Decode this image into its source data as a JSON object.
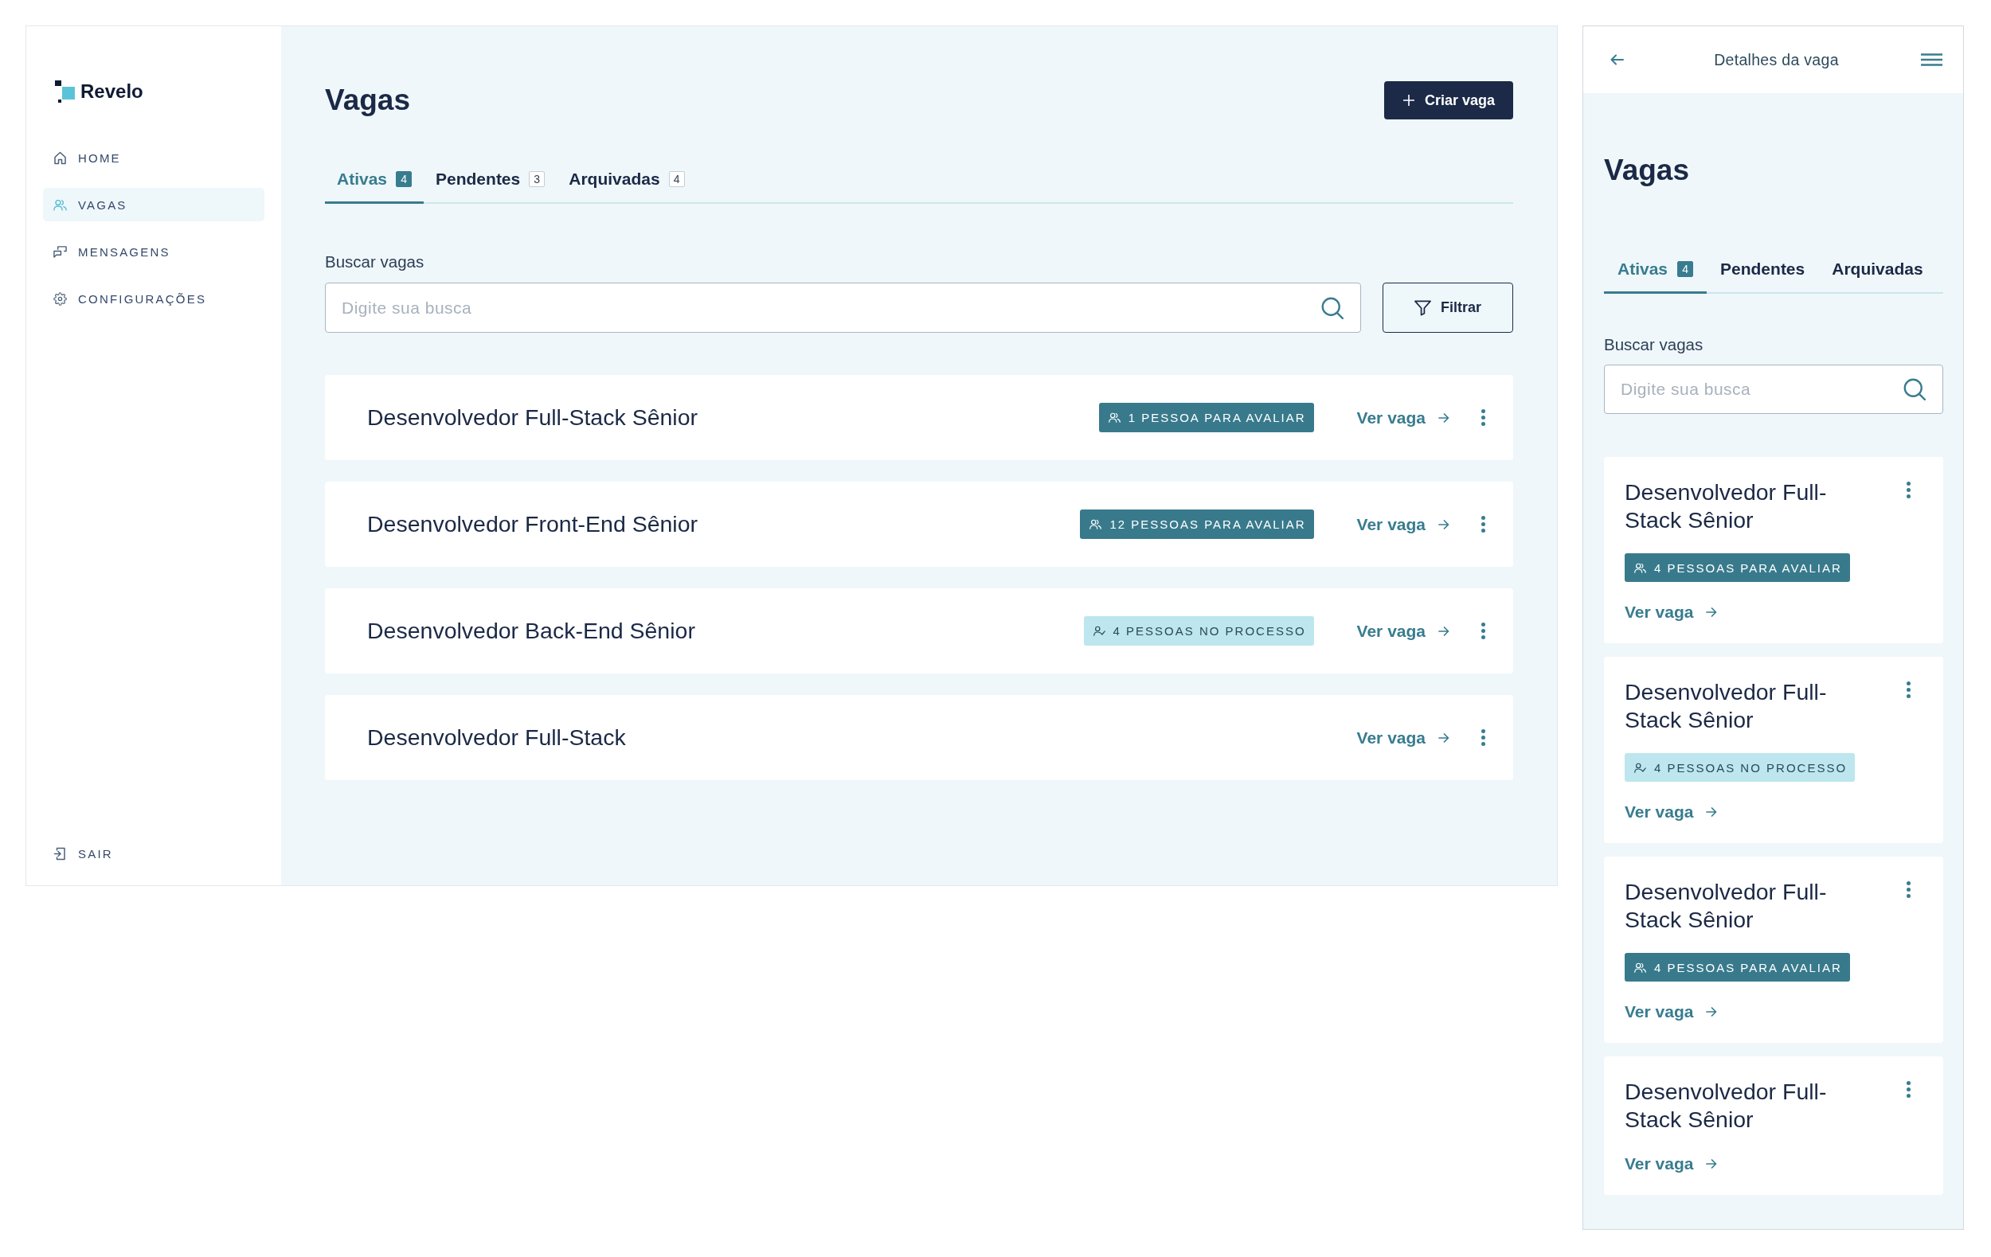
{
  "sidebar": {
    "logo": "Revelo",
    "items": [
      {
        "label": "HOME",
        "selected": false
      },
      {
        "label": "VAGAS",
        "selected": true
      },
      {
        "label": "MENSAGENS",
        "selected": false
      },
      {
        "label": "CONFIGURAÇÕES",
        "selected": false
      }
    ],
    "logout": "SAIR"
  },
  "main": {
    "title": "Vagas",
    "create_button": "Criar vaga",
    "tabs": [
      {
        "label": "Ativas",
        "count": "4",
        "selected": true
      },
      {
        "label": "Pendentes",
        "count": "3",
        "selected": false
      },
      {
        "label": "Arquivadas",
        "count": "4",
        "selected": false
      }
    ],
    "search": {
      "label": "Buscar vagas",
      "placeholder": "Digite sua busca"
    },
    "filter_button": "Filtrar",
    "jobs": [
      {
        "title": "Desenvolvedor Full-Stack Sênior",
        "badge": {
          "kind": "review",
          "text": "1 PESSOA PARA AVALIAR"
        },
        "link": "Ver vaga"
      },
      {
        "title": "Desenvolvedor Front-End Sênior",
        "badge": {
          "kind": "review",
          "text": "12 PESSOAS PARA AVALIAR"
        },
        "link": "Ver vaga"
      },
      {
        "title": "Desenvolvedor Back-End Sênior",
        "badge": {
          "kind": "process",
          "text": "4 PESSOAS NO PROCESSO"
        },
        "link": "Ver vaga"
      },
      {
        "title": "Desenvolvedor Full-Stack",
        "link": "Ver vaga"
      }
    ]
  },
  "mobile": {
    "header_title": "Detalhes da vaga",
    "title": "Vagas",
    "tabs": [
      {
        "label": "Ativas",
        "count": "4",
        "selected": true
      },
      {
        "label": "Pendentes",
        "selected": false
      },
      {
        "label": "Arquivadas",
        "selected": false
      }
    ],
    "search": {
      "label": "Buscar vagas",
      "placeholder": "Digite sua busca"
    },
    "jobs": [
      {
        "title": "Desenvolvedor Full-Stack Sênior",
        "badge": {
          "kind": "review",
          "text": "4 PESSOAS PARA AVALIAR"
        },
        "link": "Ver vaga"
      },
      {
        "title": "Desenvolvedor Full-Stack Sênior",
        "badge": {
          "kind": "process",
          "text": "4 PESSOAS NO PROCESSO"
        },
        "link": "Ver vaga"
      },
      {
        "title": "Desenvolvedor Full-Stack Sênior",
        "badge": {
          "kind": "review",
          "text": "4 PESSOAS PARA AVALIAR"
        },
        "link": "Ver vaga"
      },
      {
        "title": "Desenvolvedor Full-Stack Sênior",
        "link": "Ver vaga"
      }
    ]
  }
}
